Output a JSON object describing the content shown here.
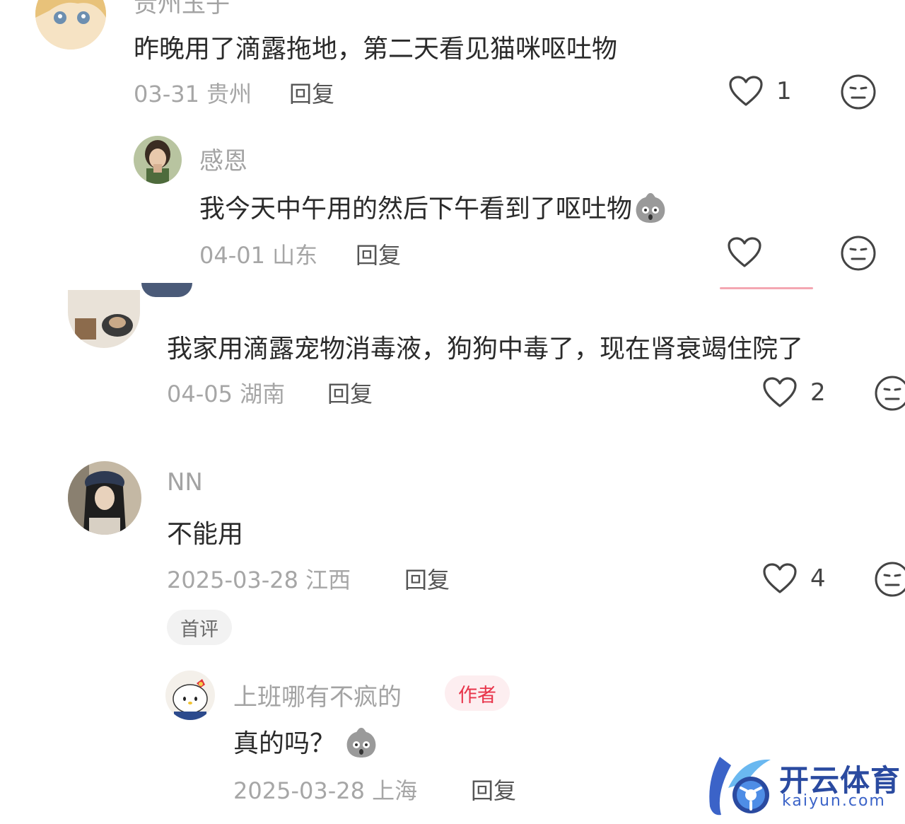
{
  "comments": [
    {
      "name": "贵州玉子",
      "text": "昨晚用了滴露拖地，第二天看见猫咪呕吐物",
      "date": "03-31",
      "location": "贵州",
      "reply_label": "回复",
      "likes": "1"
    },
    {
      "name": "感恩",
      "text": "我今天中午用的然后下午看到了呕吐物",
      "date": "04-01",
      "location": "山东",
      "reply_label": "回复",
      "likes": ""
    },
    {
      "name": "",
      "text": "我家用滴露宠物消毒液，狗狗中毒了，现在肾衰竭住院了",
      "date": "04-05",
      "location": "湖南",
      "reply_label": "回复",
      "likes": "2"
    },
    {
      "name": "NN",
      "text": "不能用",
      "date": "2025-03-28",
      "location": "江西",
      "reply_label": "回复",
      "likes": "4",
      "tag": "首评"
    },
    {
      "name": "上班哪有不疯的",
      "badge": "作者",
      "text": "真的吗？",
      "date": "2025-03-28",
      "location": "上海",
      "reply_label": "回复",
      "likes": ""
    }
  ],
  "watermark": {
    "cn": "开云体育",
    "en": "kaiyun.com"
  },
  "icons": {
    "like": "heart-outline-icon",
    "dislike": "meh-face-icon",
    "emoji": "shocked-blob-emoji"
  },
  "colors": {
    "author_badge": "#e8344a",
    "meta": "#a6a6a6",
    "watermark": "#2a4aa0"
  }
}
